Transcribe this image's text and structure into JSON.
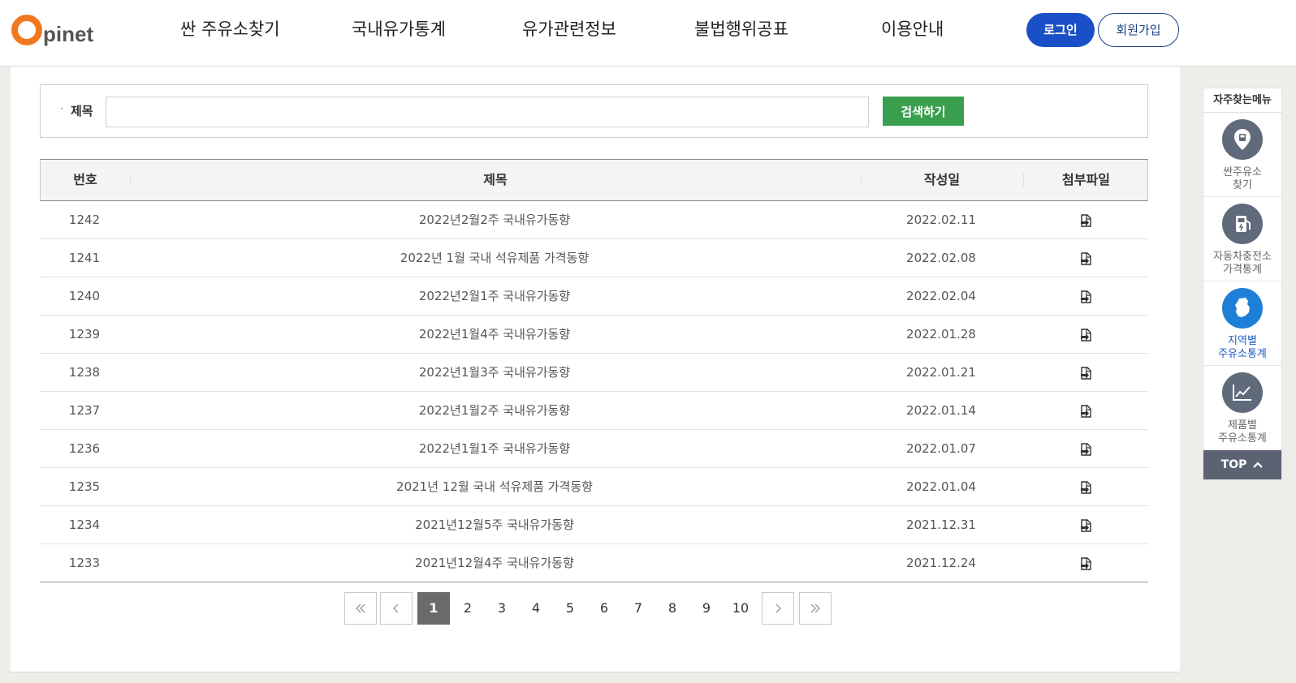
{
  "header": {
    "logo_text": "pinet",
    "nav": [
      "싼 주유소찾기",
      "국내유가통계",
      "유가관련정보",
      "불법행위공표",
      "이용안내"
    ],
    "login_label": "로그인",
    "join_label": "회원가입"
  },
  "search": {
    "label": "제목",
    "value": "",
    "button_label": "검색하기"
  },
  "table": {
    "headers": {
      "no": "번호",
      "title": "제목",
      "date": "작성일",
      "file": "첨부파일"
    },
    "rows": [
      {
        "no": "1242",
        "title": "2022년2월2주 국내유가동향",
        "date": "2022.02.11"
      },
      {
        "no": "1241",
        "title": "2022년 1월 국내 석유제품 가격동향",
        "date": "2022.02.08"
      },
      {
        "no": "1240",
        "title": "2022년2월1주 국내유가동향",
        "date": "2022.02.04"
      },
      {
        "no": "1239",
        "title": "2022년1월4주 국내유가동향",
        "date": "2022.01.28"
      },
      {
        "no": "1238",
        "title": "2022년1월3주 국내유가동향",
        "date": "2022.01.21"
      },
      {
        "no": "1237",
        "title": "2022년1월2주 국내유가동향",
        "date": "2022.01.14"
      },
      {
        "no": "1236",
        "title": "2022년1월1주 국내유가동향",
        "date": "2022.01.07"
      },
      {
        "no": "1235",
        "title": "2021년 12월 국내 석유제품 가격동향",
        "date": "2022.01.04"
      },
      {
        "no": "1234",
        "title": "2021년12월5주 국내유가동향",
        "date": "2021.12.31"
      },
      {
        "no": "1233",
        "title": "2021년12월4주 국내유가동향",
        "date": "2021.12.24"
      }
    ],
    "file_icon": "file-download-icon"
  },
  "pagination": {
    "pages": [
      "1",
      "2",
      "3",
      "4",
      "5",
      "6",
      "7",
      "8",
      "9",
      "10"
    ],
    "current": "1"
  },
  "quick_menu": {
    "title": "자주찾는메뉴",
    "items": [
      {
        "line1": "싼주유소",
        "line2": "찾기",
        "icon": "location-pin-icon"
      },
      {
        "line1": "자동차충전소",
        "line2": "가격통계",
        "icon": "charging-station-icon"
      },
      {
        "line1": "지역별",
        "line2": "주유소통계",
        "icon": "korea-map-icon"
      },
      {
        "line1": "제품별",
        "line2": "주유소통계",
        "icon": "line-chart-icon"
      }
    ],
    "top_label": "TOP"
  },
  "colors": {
    "brand_orange": "#f07820",
    "login_blue": "#1a4fc7",
    "search_green": "#3a9e4f",
    "active_page": "#6b6b6b"
  }
}
